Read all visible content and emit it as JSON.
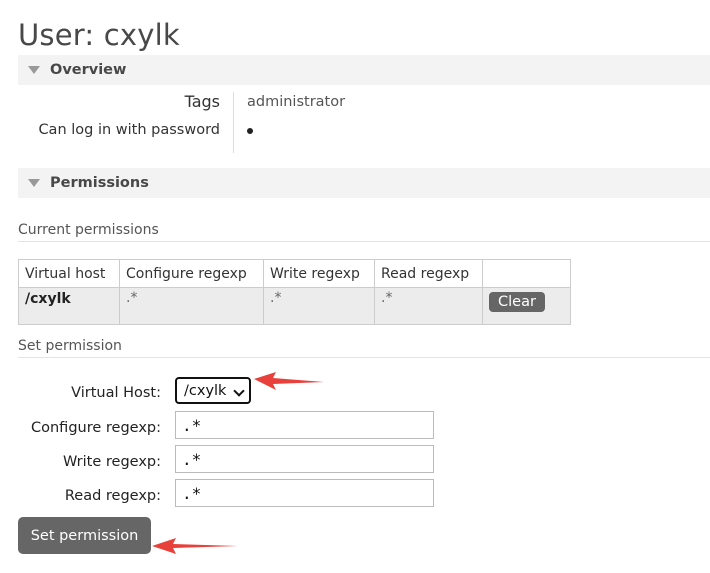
{
  "page": {
    "title": "User: cxylk"
  },
  "overview": {
    "header": "Overview",
    "tags_label": "Tags",
    "tags_value": "administrator",
    "password_label": "Can log in with password"
  },
  "permissions": {
    "header": "Permissions",
    "current_title": "Current permissions",
    "table": {
      "columns": [
        "Virtual host",
        "Configure regexp",
        "Write regexp",
        "Read regexp"
      ],
      "rows": [
        {
          "vhost": "/cxylk",
          "configure": ".*",
          "write": ".*",
          "read": ".*",
          "action": "Clear"
        }
      ]
    },
    "set_title": "Set permission",
    "form": {
      "vhost_label": "Virtual Host:",
      "vhost_selected": "/cxylk",
      "configure_label": "Configure regexp:",
      "configure_value": ".*",
      "write_label": "Write regexp:",
      "write_value": ".*",
      "read_label": "Read regexp:",
      "read_value": ".*",
      "submit_label": "Set permission"
    }
  },
  "colors": {
    "annotation_arrow": "#e8403a",
    "button_bg": "#666666",
    "header_bg": "#f3f3f3"
  }
}
